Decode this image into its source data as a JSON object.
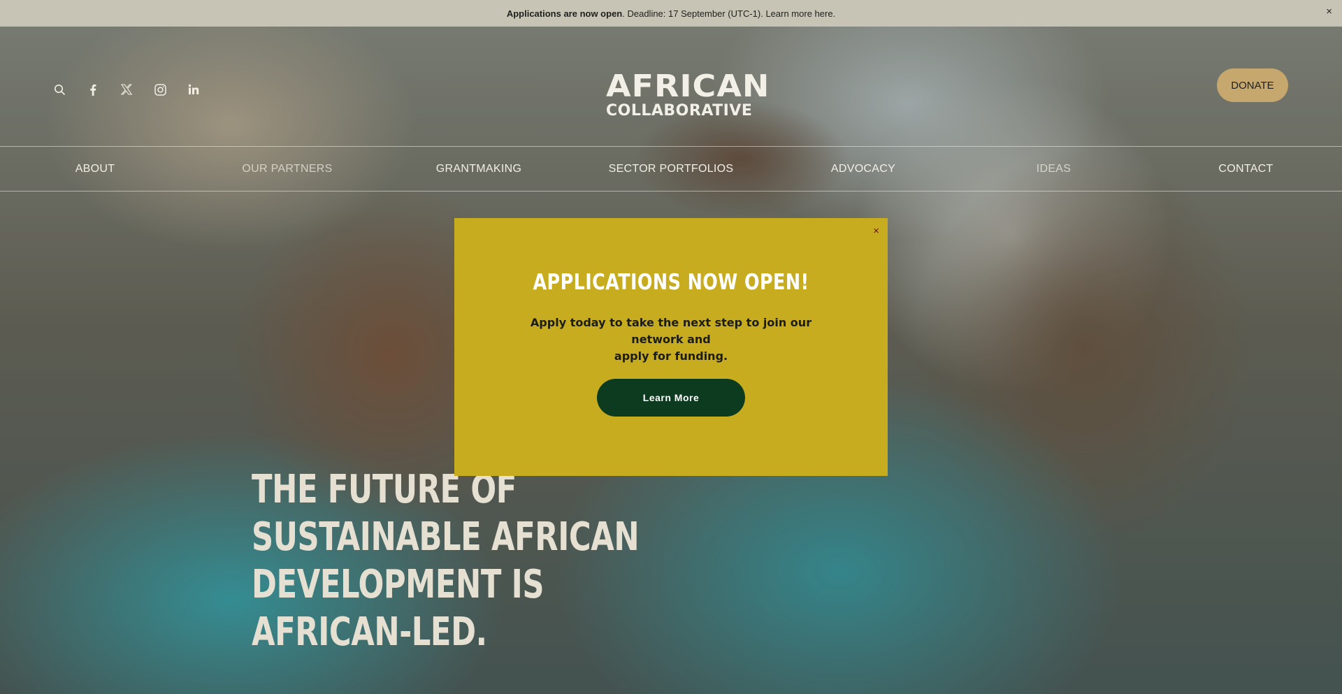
{
  "announcement": {
    "bold": "Applications are now open",
    "text": ". Deadline: 17 September (UTC-1). Learn more here.",
    "close": "×"
  },
  "header": {
    "icons": [
      "search-icon",
      "facebook-icon",
      "x-icon",
      "instagram-icon",
      "linkedin-icon"
    ],
    "logo_line1": "AFRICAN",
    "logo_line2": "COLLABORATIVE",
    "donate_label": "DONATE"
  },
  "nav": {
    "items": [
      {
        "label": "ABOUT"
      },
      {
        "label": "OUR PARTNERS"
      },
      {
        "label": "GRANTMAKING"
      },
      {
        "label": "SECTOR PORTFOLIOS"
      },
      {
        "label": "ADVOCACY"
      },
      {
        "label": "IDEAS"
      },
      {
        "label": "CONTACT"
      }
    ]
  },
  "hero": {
    "line1": "THE FUTURE OF SUSTAINABLE AFRICAN",
    "line2": "DEVELOPMENT IS AFRICAN-LED."
  },
  "modal": {
    "close": "×",
    "title": "APPLICATIONS NOW OPEN!",
    "body_line1": "Apply today to take the next step to join our network and",
    "body_line2": "apply for funding.",
    "button_label": "Learn More"
  },
  "colors": {
    "announcement_bg": "#c7c4b6",
    "modal_bg": "#c7ac1f",
    "button_bg": "#0d3b1f",
    "donate_bg": "#c6a86e"
  }
}
